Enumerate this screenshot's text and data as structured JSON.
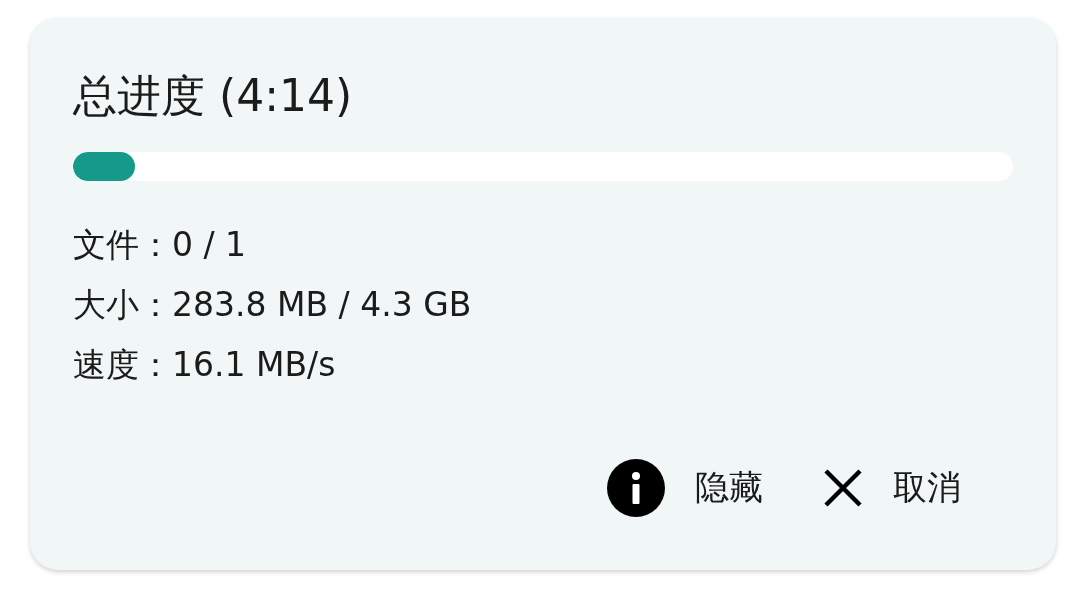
{
  "dialog": {
    "title": "总进度 (4:14)",
    "progress": {
      "level": 0.066
    },
    "stats": [
      "文件：0 / 1",
      "大小：283.8 MB / 4.3 GB",
      "速度：16.1 MB/s"
    ],
    "buttons": [
      {
        "kind": "info",
        "label": "隐藏"
      },
      {
        "kind": "close",
        "label": "取消"
      }
    ]
  }
}
